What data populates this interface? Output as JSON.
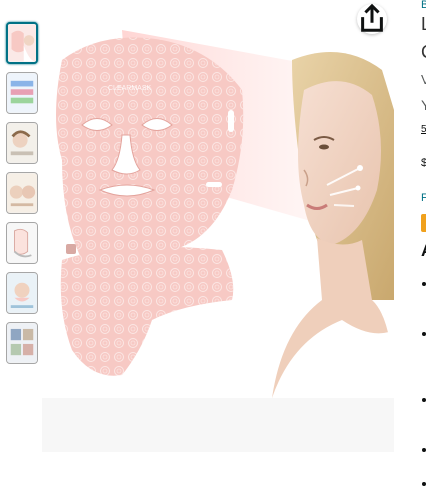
{
  "thumbnails": [
    {
      "name": "thumb-1",
      "selected": true
    },
    {
      "name": "thumb-2",
      "selected": false
    },
    {
      "name": "thumb-3",
      "selected": false
    },
    {
      "name": "thumb-4",
      "selected": false
    },
    {
      "name": "thumb-5",
      "selected": false
    },
    {
      "name": "thumb-6",
      "selected": false
    },
    {
      "name": "thumb-7",
      "selected": false
    }
  ],
  "main_image": {
    "mask_brand_text": "CLEARMASK",
    "icon": "share-icon"
  },
  "product": {
    "brand_link": "B",
    "title_line1": "L",
    "title_line2": "C",
    "visit_link": "V",
    "rating_text": "Y",
    "bought_text": "5",
    "price_text": "$",
    "returns_text": "F",
    "about_heading": "A"
  },
  "colors": {
    "accent_link": "#007185",
    "badge": "#f0a11d",
    "mask_pink": "#f7c9c4"
  }
}
